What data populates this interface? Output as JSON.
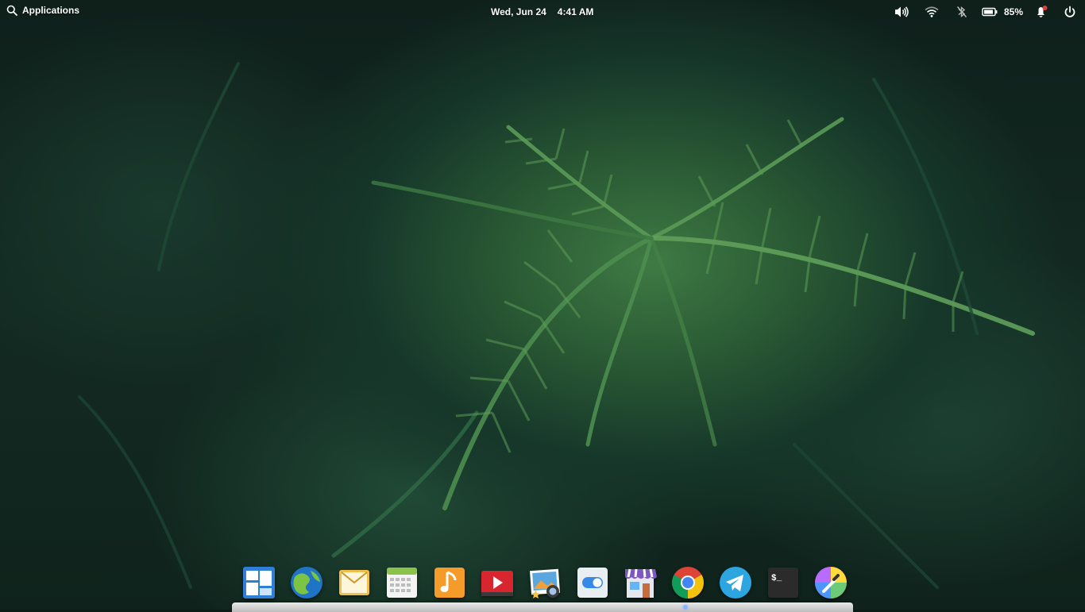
{
  "panel": {
    "applications_label": "Applications",
    "date": "Wed, Jun 24",
    "time": "4:41 AM",
    "battery_percent": "85%",
    "notification_badge_color": "#e53935"
  },
  "dock": {
    "items": [
      {
        "name": "multitasking-view",
        "icon": "multitasking-icon"
      },
      {
        "name": "web-browser",
        "icon": "epiphany-icon"
      },
      {
        "name": "mail",
        "icon": "mail-icon"
      },
      {
        "name": "calendar",
        "icon": "calendar-icon"
      },
      {
        "name": "music",
        "icon": "music-icon"
      },
      {
        "name": "videos",
        "icon": "videos-icon"
      },
      {
        "name": "photos",
        "icon": "photos-icon"
      },
      {
        "name": "system-settings",
        "icon": "settings-toggle-icon"
      },
      {
        "name": "appcenter",
        "icon": "appcenter-store-icon"
      },
      {
        "name": "chrome",
        "icon": "chrome-icon"
      },
      {
        "name": "telegram",
        "icon": "telegram-icon"
      },
      {
        "name": "terminal",
        "icon": "terminal-icon"
      },
      {
        "name": "color-picker",
        "icon": "color-picker-icon"
      }
    ]
  }
}
